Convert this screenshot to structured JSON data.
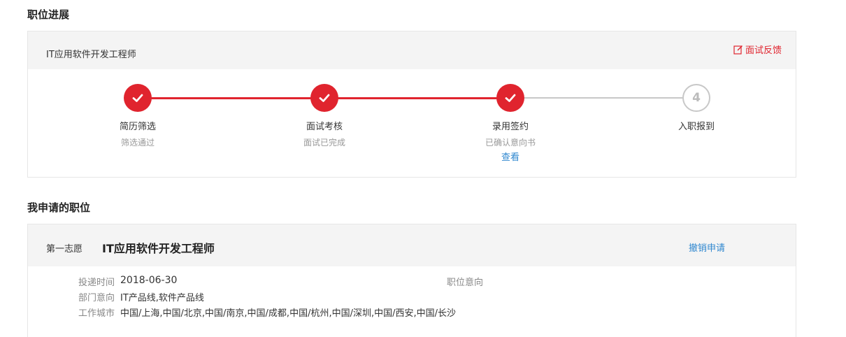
{
  "progress_section": {
    "title": "职位进展",
    "job_title": "IT应用软件开发工程师",
    "feedback_label": "面试反馈",
    "steps": [
      {
        "name": "简历筛选",
        "status": "筛选通过",
        "state": "done"
      },
      {
        "name": "面试考核",
        "status": "面试已完成",
        "state": "done"
      },
      {
        "name": "录用签约",
        "status": "已确认意向书",
        "link": "查看",
        "state": "done"
      },
      {
        "name": "入职报到",
        "number": "4",
        "state": "todo"
      }
    ]
  },
  "applications_section": {
    "title": "我申请的职位",
    "choice_label": "第一志愿",
    "job_title": "IT应用软件开发工程师",
    "withdraw_label": "撤销申请",
    "fields": {
      "submit_time_label": "投递时间",
      "submit_time_value": "2018-06-30",
      "position_intent_label": "职位意向",
      "dept_label": "部门意向",
      "dept_value": "IT产品线,软件产品线",
      "city_label": "工作城市",
      "city_value": "中国/上海,中国/北京,中国/南京,中国/成都,中国/杭州,中国/深圳,中国/西安,中国/长沙"
    }
  },
  "colors": {
    "accent_red": "#e0242e",
    "link_blue": "#2f87cf",
    "pending_gray": "#c8c8c8"
  }
}
